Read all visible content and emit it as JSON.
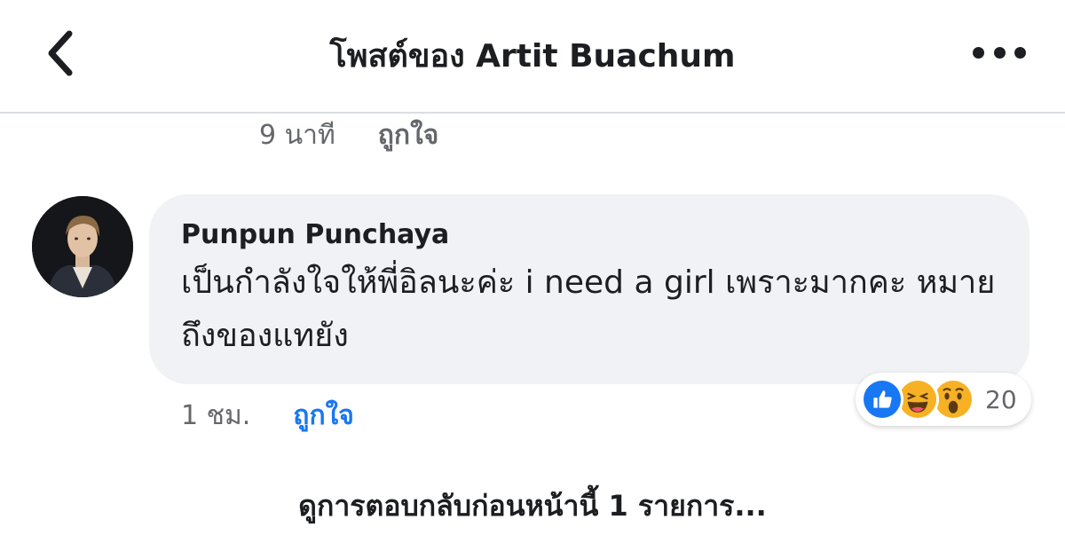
{
  "header": {
    "title": "โพสต์ของ Artit Buachum",
    "back_icon": "chevron-left-icon",
    "more_icon": "more-horizontal-icon"
  },
  "previous_comment": {
    "time": "9 นาที",
    "like_label": "ถูกใจ"
  },
  "comment": {
    "author": "Punpun Punchaya",
    "text": "เป็นกำลังใจให้พี่อิลนะค่ะ i need a girl เพราะมากคะ หมายถึงของแทยัง",
    "time": "1 ชม.",
    "like_label": "ถูกใจ",
    "reactions": {
      "icons": [
        "like-reaction-icon",
        "haha-reaction-icon",
        "wow-reaction-icon"
      ],
      "count": "20"
    }
  },
  "view_previous_replies": "ดูการตอบกลับก่อนหน้านี้ 1 รายการ...",
  "colors": {
    "accent": "#1877f2",
    "bubble": "#f0f2f5",
    "secondary_text": "#65676b",
    "primary_text": "#1c1e21"
  }
}
